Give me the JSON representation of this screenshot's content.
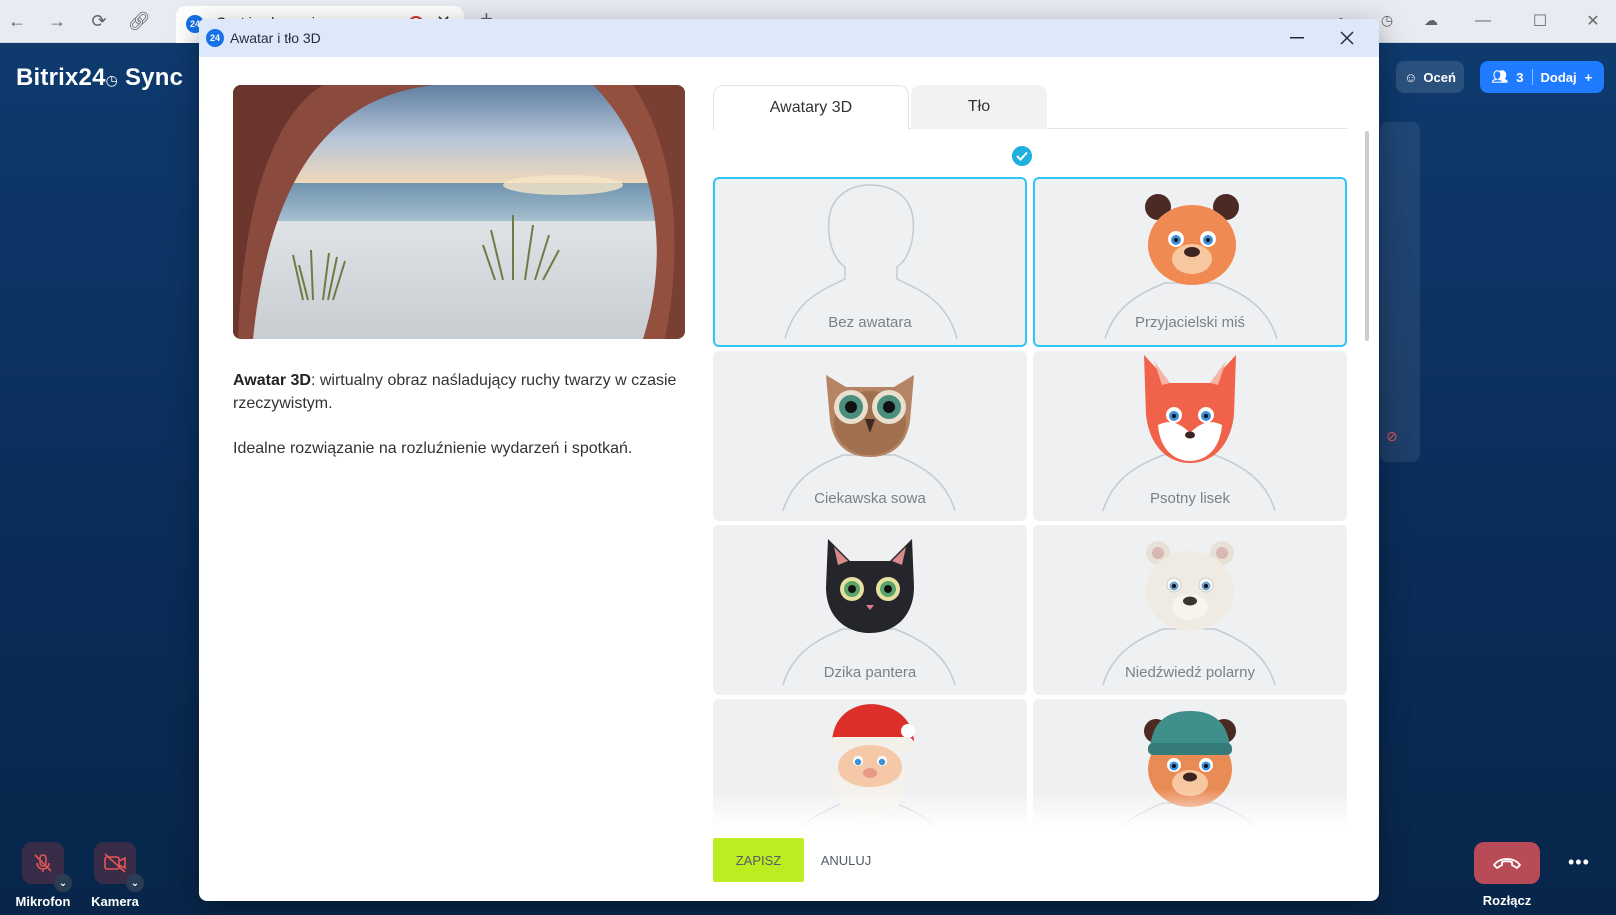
{
  "browser": {
    "tab_title": "Czat i połączenia",
    "tab_favicon": "24",
    "icons": [
      "back-icon",
      "forward-icon",
      "reload-icon",
      "link-icon",
      "info-icon",
      "history-icon",
      "cloud-icon"
    ]
  },
  "app": {
    "logo": "Bitrix24",
    "logo_suffix": "Sync",
    "rate_label": "Oceń",
    "participants_count": "3",
    "add_label": "Dodaj",
    "controls": {
      "mic_label": "Mikrofon",
      "camera_label": "Kamera",
      "hangup_label": "Rozłącz"
    },
    "colors": {
      "accent": "#1f7bff",
      "hangup": "#b94a57"
    }
  },
  "modal": {
    "favicon": "24",
    "title": "Awatar i tło 3D",
    "description": {
      "bold": "Awatar 3D",
      "rest": ": wirtualny obraz naśladujący ruchy twarzy w czasie rzeczywistym.",
      "paragraph2": "Idealne rozwiązanie na rozluźnienie wydarzeń i spotkań."
    },
    "tabs": [
      {
        "label": "Awatary 3D",
        "active": true
      },
      {
        "label": "Tło",
        "active": false
      }
    ],
    "avatars": [
      {
        "label": "Bez awatara",
        "selected": true,
        "icon": "person-silhouette-icon"
      },
      {
        "label": "Przyjacielski miś",
        "selected": true,
        "icon": "bear-face-icon"
      },
      {
        "label": "Ciekawska sowa",
        "selected": false,
        "icon": "owl-face-icon"
      },
      {
        "label": "Psotny lisek",
        "selected": false,
        "icon": "fox-face-icon"
      },
      {
        "label": "Dzika pantera",
        "selected": false,
        "icon": "black-cat-face-icon"
      },
      {
        "label": "Niedźwiedź polarny",
        "selected": false,
        "icon": "polar-bear-face-icon"
      },
      {
        "label": "",
        "selected": false,
        "icon": "santa-face-icon"
      },
      {
        "label": "",
        "selected": false,
        "icon": "bear-beanie-face-icon"
      }
    ],
    "save_label": "ZAPISZ",
    "cancel_label": "ANULUJ",
    "colors": {
      "save_bg": "#bbed21",
      "selection_border": "#2fc6f6",
      "titlebar": "#dde9fb"
    }
  }
}
